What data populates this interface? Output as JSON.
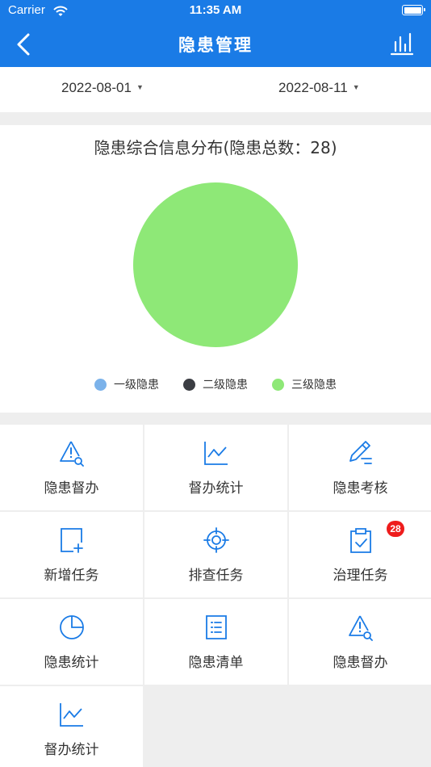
{
  "status_bar": {
    "carrier": "Carrier",
    "time": "11:35 AM"
  },
  "nav": {
    "title": "隐患管理",
    "back_icon": "chevron-left-icon",
    "right_icon": "bar-chart-icon"
  },
  "date_range": {
    "start": "2022-08-01",
    "end": "2022-08-11"
  },
  "chart_section": {
    "title": "隐患综合信息分布(隐患总数：28)",
    "legend": [
      {
        "label": "一级隐患",
        "color": "#7bb2ea"
      },
      {
        "label": "二级隐患",
        "color": "#3b3d43"
      },
      {
        "label": "三级隐患",
        "color": "#8ee877"
      }
    ]
  },
  "chart_data": {
    "type": "pie",
    "title": "隐患综合信息分布(隐患总数：28)",
    "labels": [
      "一级隐患",
      "二级隐患",
      "三级隐患"
    ],
    "values": [
      0,
      0,
      28
    ],
    "colors": [
      "#7bb2ea",
      "#3b3d43",
      "#8ee877"
    ],
    "legend_position": "bottom"
  },
  "menu": [
    {
      "label": "隐患督办",
      "icon": "warning-search-icon"
    },
    {
      "label": "督办统计",
      "icon": "line-chart-icon"
    },
    {
      "label": "隐患考核",
      "icon": "edit-pen-icon"
    },
    {
      "label": "新增任务",
      "icon": "add-document-icon"
    },
    {
      "label": "排查任务",
      "icon": "target-icon"
    },
    {
      "label": "治理任务",
      "icon": "clipboard-check-icon",
      "badge": "28"
    },
    {
      "label": "隐患统计",
      "icon": "pie-chart-icon"
    },
    {
      "label": "隐患清单",
      "icon": "list-document-icon"
    },
    {
      "label": "隐患督办",
      "icon": "warning-search-icon"
    },
    {
      "label": "督办统计",
      "icon": "line-chart-icon"
    }
  ],
  "colors": {
    "primary": "#1a7be6",
    "icon": "#1a7be6",
    "badge": "#ee1c1c"
  }
}
